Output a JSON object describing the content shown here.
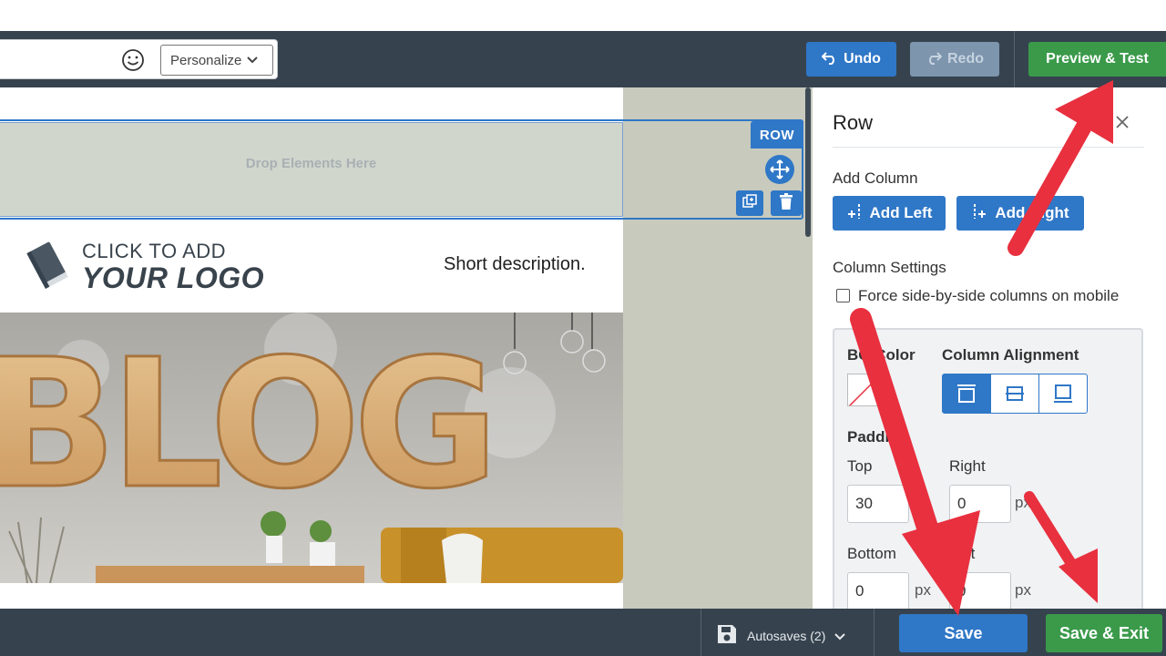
{
  "toolbar": {
    "personalize_label": "Personalize",
    "undo_label": "Undo",
    "redo_label": "Redo",
    "preview_label": "Preview & Test"
  },
  "canvas": {
    "drop_text": "Drop Elements Here",
    "row_label": "ROW",
    "logo_line1": "CLICK TO ADD",
    "logo_line2": "YOUR LOGO",
    "short_description": "Short description.",
    "hero_text": "BLOG"
  },
  "panel": {
    "title": "Row",
    "add_column_label": "Add Column",
    "add_left_label": "Add Left",
    "add_right_label": "Add Right",
    "column_settings_label": "Column Settings",
    "force_side_by_side_label": "Force side-by-side columns on mobile",
    "bg_color_label": "BG Color",
    "column_alignment_label": "Column Alignment",
    "padding_label": "Padding",
    "top_label": "Top",
    "right_label": "Right",
    "bottom_label": "Bottom",
    "left_label": "Left",
    "top_value": "30",
    "right_value": "0",
    "bottom_value": "0",
    "left_value": "0",
    "px_unit": "px"
  },
  "bottombar": {
    "autosaves_label": "Autosaves (2)",
    "save_label": "Save",
    "save_exit_label": "Save & Exit"
  },
  "colors": {
    "toolbar_bg": "#36434f",
    "primary_blue": "#2f77c7",
    "success_green": "#3a9a4a",
    "annotation_red": "#e8303f"
  },
  "icons": [
    "smile-icon",
    "chevron-down-icon",
    "undo-icon",
    "redo-icon",
    "move-icon",
    "duplicate-icon",
    "trash-icon",
    "close-icon",
    "add-left-icon",
    "add-right-icon",
    "align-top-icon",
    "align-middle-icon",
    "align-bottom-icon",
    "save-disk-icon",
    "book-icon"
  ]
}
